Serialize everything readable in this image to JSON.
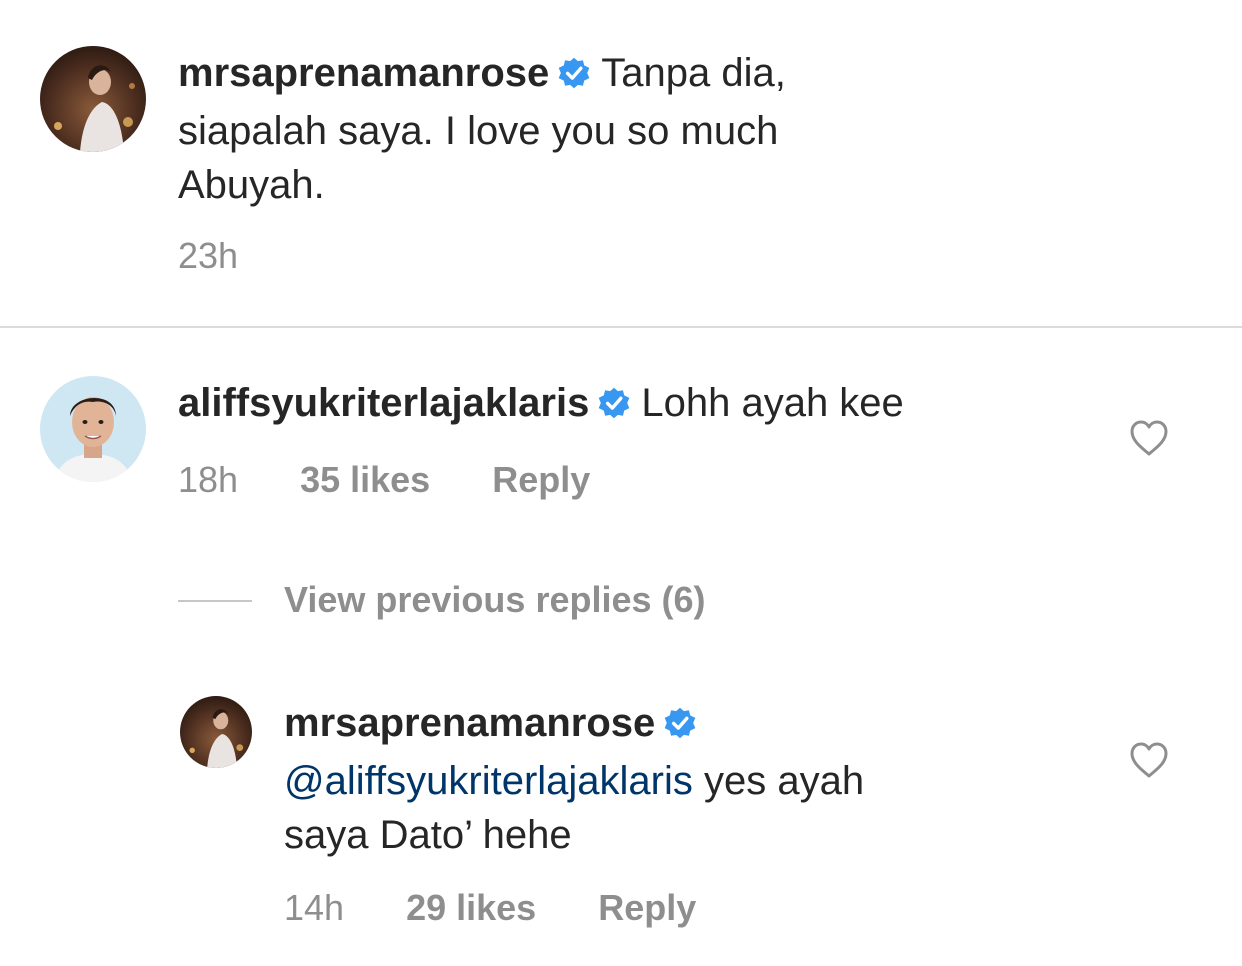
{
  "comments": [
    {
      "username": "mrsaprenamanrose",
      "text": "Tanpa dia, siapalah saya. I love you so much Abuyah.",
      "line1": "Tanpa dia,",
      "line2": "siapalah saya. I love you so much",
      "line3": "Abuyah.",
      "time": "23h"
    },
    {
      "username": "aliffsyukriterlajaklaris",
      "text": "Lohh ayah kee",
      "time": "18h",
      "likes": "35 likes",
      "reply_label": "Reply"
    }
  ],
  "view_previous_replies": "View previous replies (6)",
  "reply": {
    "username": "mrsaprenamanrose",
    "mention": "@aliffsyukriterlajaklaris",
    "text_after_mention": " yes ayah",
    "line2": "saya Dato’ hehe",
    "time": "14h",
    "likes": "29 likes",
    "reply_label": "Reply"
  },
  "colors": {
    "verified": "#3897f0",
    "mention": "#003569",
    "secondary_text": "#8e8e8e",
    "divider": "#dbdbdb"
  },
  "icons": {
    "verified": "verified-badge-icon",
    "like": "heart-outline-icon"
  }
}
